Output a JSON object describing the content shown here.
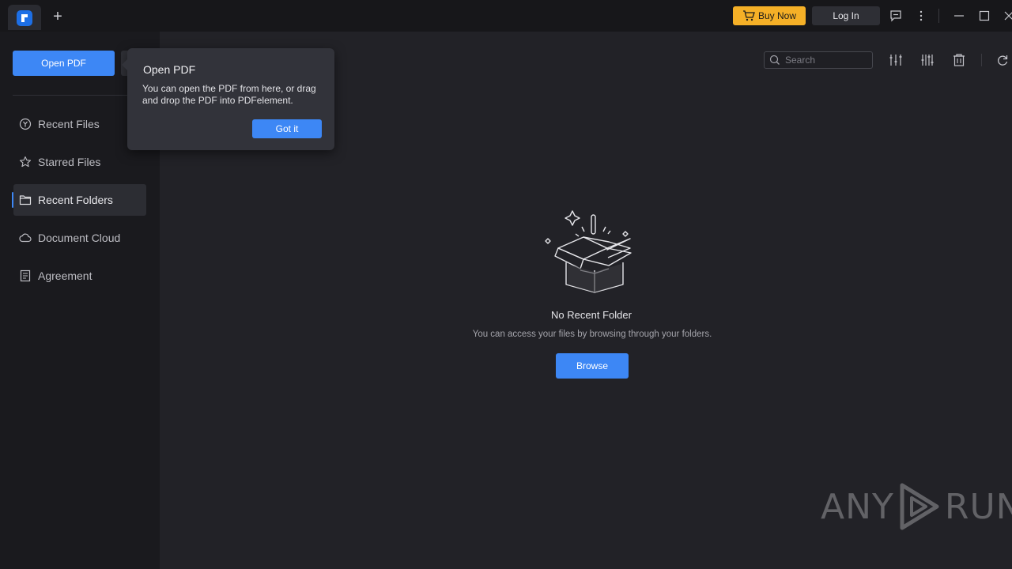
{
  "titlebar": {
    "buy_now": "Buy Now",
    "log_in": "Log In",
    "new_tab": "+"
  },
  "sidebar": {
    "open_pdf": "Open PDF",
    "items": [
      {
        "label": "Recent Files",
        "icon": "clock-icon"
      },
      {
        "label": "Starred Files",
        "icon": "star-icon"
      },
      {
        "label": "Recent Folders",
        "icon": "folder-icon",
        "active": true
      },
      {
        "label": "Document Cloud",
        "icon": "cloud-icon"
      },
      {
        "label": "Agreement",
        "icon": "document-icon"
      }
    ]
  },
  "toolbar": {
    "search_placeholder": "Search"
  },
  "empty_state": {
    "title": "No Recent Folder",
    "subtitle": "You can access your files by browsing through your folders.",
    "browse": "Browse"
  },
  "popover": {
    "title": "Open PDF",
    "text": "You can open the PDF from here, or drag and drop the PDF into PDFelement.",
    "button": "Got it"
  },
  "watermark": {
    "left": "ANY",
    "right": "RUN"
  },
  "colors": {
    "accent": "#3d87f5",
    "buy_now": "#f5b027",
    "sidebar_bg": "#1a1a1e",
    "main_bg": "#222227"
  }
}
